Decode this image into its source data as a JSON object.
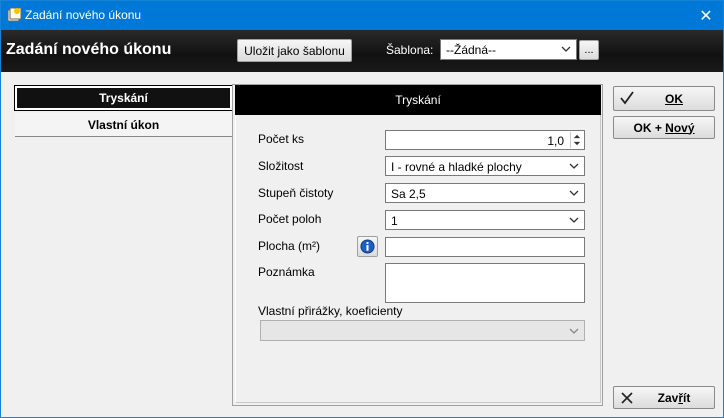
{
  "window": {
    "title": "Zadání nového úkonu",
    "close_glyph": "✕"
  },
  "header": {
    "title": "Zadání nového úkonu",
    "save_template_label": "Uložit jako šablonu",
    "template_label": "Šablona:",
    "template_value": "--Žádná--",
    "dots_label": "..."
  },
  "tabs": [
    {
      "label": "Tryskání",
      "active": true
    },
    {
      "label": "Vlastní úkon",
      "active": false
    }
  ],
  "form": {
    "header": "Tryskání",
    "fields": {
      "count_label": "Počet ks",
      "count_value": "1,0",
      "complexity_label": "Složitost",
      "complexity_value": "I - rovné a hladké plochy",
      "cleanliness_label": "Stupeň čistoty",
      "cleanliness_value": "Sa 2,5",
      "positions_label": "Počet poloh",
      "positions_value": "1",
      "area_label": "Plocha (m²)",
      "area_value": "",
      "note_label": "Poznámka",
      "note_value": "",
      "surcharge_label": "Vlastní přirážky, koeficienty",
      "surcharge_value": ""
    }
  },
  "actions": {
    "ok_label": "OK",
    "ok_new_label_1": "OK + ",
    "ok_new_label_2": "Nový",
    "close_label_1": "Zav",
    "close_label_2": "ř",
    "close_label_3": "ít"
  },
  "icons": {
    "app": "app-icon",
    "close": "close-icon",
    "dropdown": "chevron-down-icon",
    "info": "info-icon",
    "ok": "checkmark-icon",
    "cancel": "x-icon"
  },
  "colors": {
    "titlebar": "#0078d7",
    "header_bg": "#111111",
    "tab_active_bg": "#111111"
  }
}
